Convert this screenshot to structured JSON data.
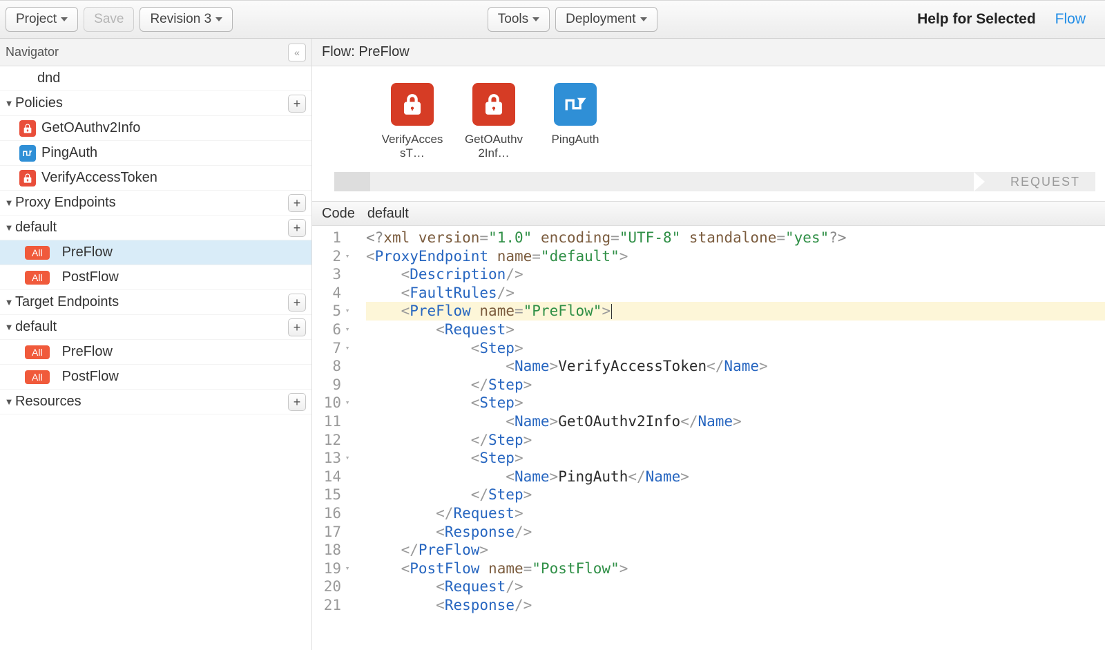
{
  "toolbar": {
    "project_label": "Project",
    "save_label": "Save",
    "revision_label": "Revision 3",
    "tools_label": "Tools",
    "deployment_label": "Deployment",
    "help_label": "Help for Selected",
    "flow_link": "Flow"
  },
  "sidebar": {
    "title": "Navigator",
    "project_name": "dnd",
    "sections": {
      "policies": "Policies",
      "proxy_endpoints": "Proxy Endpoints",
      "target_endpoints": "Target Endpoints",
      "resources": "Resources"
    },
    "policies_items": [
      {
        "label": "GetOAuthv2Info",
        "icon": "red-lock"
      },
      {
        "label": "PingAuth",
        "icon": "blue-flow"
      },
      {
        "label": "VerifyAccessToken",
        "icon": "red-lock"
      }
    ],
    "proxy_default": "default",
    "proxy_flows": [
      {
        "badge": "All",
        "label": "PreFlow",
        "selected": true
      },
      {
        "badge": "All",
        "label": "PostFlow"
      }
    ],
    "target_default": "default",
    "target_flows": [
      {
        "badge": "All",
        "label": "PreFlow"
      },
      {
        "badge": "All",
        "label": "PostFlow"
      }
    ]
  },
  "flow": {
    "header": "Flow: PreFlow",
    "nodes": [
      {
        "label": "VerifyAccessT…",
        "icon": "red-lock"
      },
      {
        "label": "GetOAuthv2Inf…",
        "icon": "red-lock"
      },
      {
        "label": "PingAuth",
        "icon": "blue-flow"
      }
    ],
    "request_label": "REQUEST"
  },
  "code_header": {
    "left": "Code",
    "right": "default"
  },
  "code": {
    "highlight_line": 5,
    "lines": [
      {
        "n": 1,
        "fold": "",
        "html": "<span class='t-meta'>&lt;?</span><span class='t-key'>xml</span> <span class='t-attr'>version</span><span class='t-punc'>=</span><span class='t-str'>\"1.0\"</span> <span class='t-attr'>encoding</span><span class='t-punc'>=</span><span class='t-str'>\"UTF-8\"</span> <span class='t-attr'>standalone</span><span class='t-punc'>=</span><span class='t-str'>\"yes\"</span><span class='t-meta'>?&gt;</span>"
      },
      {
        "n": 2,
        "fold": "▾",
        "html": "<span class='t-punc'>&lt;</span><span class='t-tag'>ProxyEndpoint</span> <span class='t-attr'>name</span><span class='t-punc'>=</span><span class='t-str'>\"default\"</span><span class='t-punc'>&gt;</span>"
      },
      {
        "n": 3,
        "fold": "",
        "html": "    <span class='t-punc'>&lt;</span><span class='t-tag'>Description</span><span class='t-punc'>/&gt;</span>"
      },
      {
        "n": 4,
        "fold": "",
        "html": "    <span class='t-punc'>&lt;</span><span class='t-tag'>FaultRules</span><span class='t-punc'>/&gt;</span>"
      },
      {
        "n": 5,
        "fold": "▾",
        "html": "    <span class='t-punc'>&lt;</span><span class='t-tag'>PreFlow</span> <span class='t-attr'>name</span><span class='t-punc'>=</span><span class='t-str'>\"PreFlow\"</span><span class='t-punc'>&gt;</span><span class='cursor'></span>"
      },
      {
        "n": 6,
        "fold": "▾",
        "html": "        <span class='t-punc'>&lt;</span><span class='t-tag'>Request</span><span class='t-punc'>&gt;</span>"
      },
      {
        "n": 7,
        "fold": "▾",
        "html": "            <span class='t-punc'>&lt;</span><span class='t-tag'>Step</span><span class='t-punc'>&gt;</span>"
      },
      {
        "n": 8,
        "fold": "",
        "html": "                <span class='t-punc'>&lt;</span><span class='t-tag'>Name</span><span class='t-punc'>&gt;</span><span class='t-name'>VerifyAccessToken</span><span class='t-punc'>&lt;/</span><span class='t-tag'>Name</span><span class='t-punc'>&gt;</span>"
      },
      {
        "n": 9,
        "fold": "",
        "html": "            <span class='t-punc'>&lt;/</span><span class='t-tag'>Step</span><span class='t-punc'>&gt;</span>"
      },
      {
        "n": 10,
        "fold": "▾",
        "html": "            <span class='t-punc'>&lt;</span><span class='t-tag'>Step</span><span class='t-punc'>&gt;</span>"
      },
      {
        "n": 11,
        "fold": "",
        "html": "                <span class='t-punc'>&lt;</span><span class='t-tag'>Name</span><span class='t-punc'>&gt;</span><span class='t-name'>GetOAuthv2Info</span><span class='t-punc'>&lt;/</span><span class='t-tag'>Name</span><span class='t-punc'>&gt;</span>"
      },
      {
        "n": 12,
        "fold": "",
        "html": "            <span class='t-punc'>&lt;/</span><span class='t-tag'>Step</span><span class='t-punc'>&gt;</span>"
      },
      {
        "n": 13,
        "fold": "▾",
        "html": "            <span class='t-punc'>&lt;</span><span class='t-tag'>Step</span><span class='t-punc'>&gt;</span>"
      },
      {
        "n": 14,
        "fold": "",
        "html": "                <span class='t-punc'>&lt;</span><span class='t-tag'>Name</span><span class='t-punc'>&gt;</span><span class='t-name'>PingAuth</span><span class='t-punc'>&lt;/</span><span class='t-tag'>Name</span><span class='t-punc'>&gt;</span>"
      },
      {
        "n": 15,
        "fold": "",
        "html": "            <span class='t-punc'>&lt;/</span><span class='t-tag'>Step</span><span class='t-punc'>&gt;</span>"
      },
      {
        "n": 16,
        "fold": "",
        "html": "        <span class='t-punc'>&lt;/</span><span class='t-tag'>Request</span><span class='t-punc'>&gt;</span>"
      },
      {
        "n": 17,
        "fold": "",
        "html": "        <span class='t-punc'>&lt;</span><span class='t-tag'>Response</span><span class='t-punc'>/&gt;</span>"
      },
      {
        "n": 18,
        "fold": "",
        "html": "    <span class='t-punc'>&lt;/</span><span class='t-tag'>PreFlow</span><span class='t-punc'>&gt;</span>"
      },
      {
        "n": 19,
        "fold": "▾",
        "html": "    <span class='t-punc'>&lt;</span><span class='t-tag'>PostFlow</span> <span class='t-attr'>name</span><span class='t-punc'>=</span><span class='t-str'>\"PostFlow\"</span><span class='t-punc'>&gt;</span>"
      },
      {
        "n": 20,
        "fold": "",
        "html": "        <span class='t-punc'>&lt;</span><span class='t-tag'>Request</span><span class='t-punc'>/&gt;</span>"
      },
      {
        "n": 21,
        "fold": "",
        "html": "        <span class='t-punc'>&lt;</span><span class='t-tag'>Response</span><span class='t-punc'>/&gt;</span>"
      }
    ]
  }
}
